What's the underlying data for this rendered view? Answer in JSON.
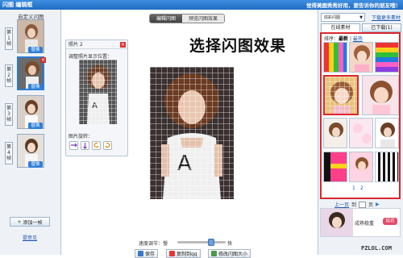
{
  "titlebar": {
    "title": "闪图 编辑框",
    "notice": "觉得美图秀秀好用，要告诉你的朋友哦！"
  },
  "left_panel": {
    "header": "自定义闪图",
    "frames": [
      {
        "label": "第1帧",
        "replace": "替换"
      },
      {
        "label": "第2帧",
        "replace": "替换"
      },
      {
        "label": "第3帧",
        "replace": "替换"
      },
      {
        "label": "第4帧",
        "replace": "替换"
      }
    ],
    "add_frame": "添加一帧",
    "feedback": "提意见"
  },
  "main": {
    "tabs": [
      "编辑闪图",
      "预览闪图效果"
    ],
    "overlay_text": "选择闪图效果",
    "photo_panel": {
      "title": "照片 2",
      "adjust_label": "调整照片显示位置：",
      "rotate_label": "图片旋转："
    },
    "speed_label": "速度调节：慢",
    "speed_fast": "快",
    "speed_value": 0.7,
    "buttons": {
      "save": "保存",
      "copy": "复制到qq",
      "resize": "修改闪图大小"
    }
  },
  "right_panel": {
    "dropdown": "炫彩闪图",
    "download_link": "下载更多素材",
    "tab_online": "在线素材",
    "tab_downloaded": "已下载(1)",
    "sort_label": "排序：",
    "sort_latest": "最新",
    "sort_hot": "最热",
    "pages": [
      "1",
      "2"
    ],
    "pager_prev": "上一页",
    "pager_goto": "到",
    "pager_page": "页",
    "ad_text": "成熟稳重",
    "ad_button": "延迟"
  },
  "watermark": "PZLOL.COM",
  "colors": {
    "accent": "#1f6cc4",
    "highlight": "#d9272e"
  }
}
